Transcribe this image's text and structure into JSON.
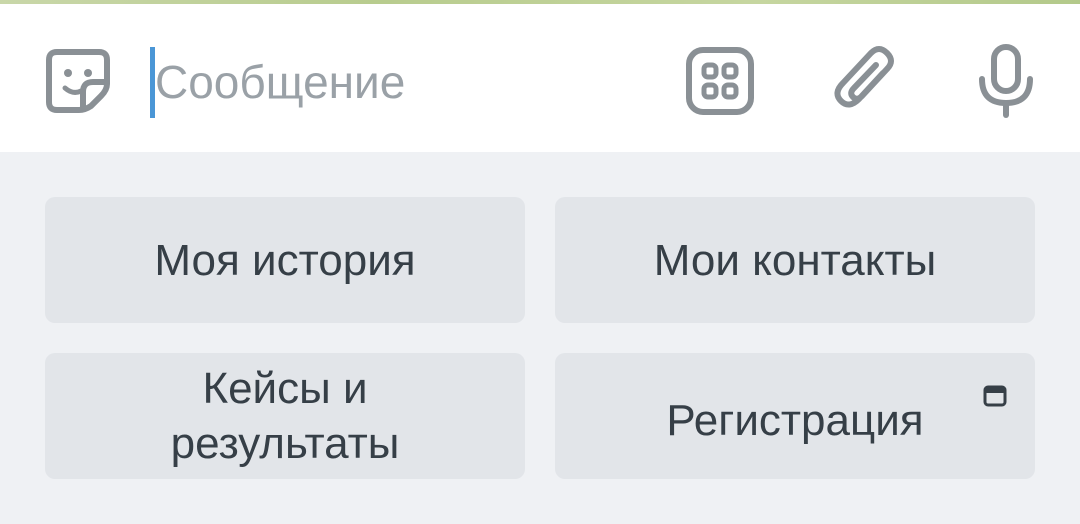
{
  "composer": {
    "placeholder": "Сообщение",
    "value": "",
    "icons": {
      "sticker": "sticker-icon",
      "bot_menu": "bot-menu-icon",
      "attach": "paperclip-icon",
      "mic": "microphone-icon"
    }
  },
  "keyboard": {
    "buttons": [
      {
        "label": "Моя история"
      },
      {
        "label": "Мои контакты"
      },
      {
        "label": "Кейсы и результаты"
      },
      {
        "label": "Регистрация",
        "icon": "web-app-icon"
      }
    ]
  },
  "colors": {
    "caret": "#4a96d6",
    "icon": "#8a9095",
    "keyboard_bg": "#eff1f4",
    "button_bg": "#e2e5e9",
    "button_text": "#363f47",
    "placeholder": "#9aa1a7"
  }
}
